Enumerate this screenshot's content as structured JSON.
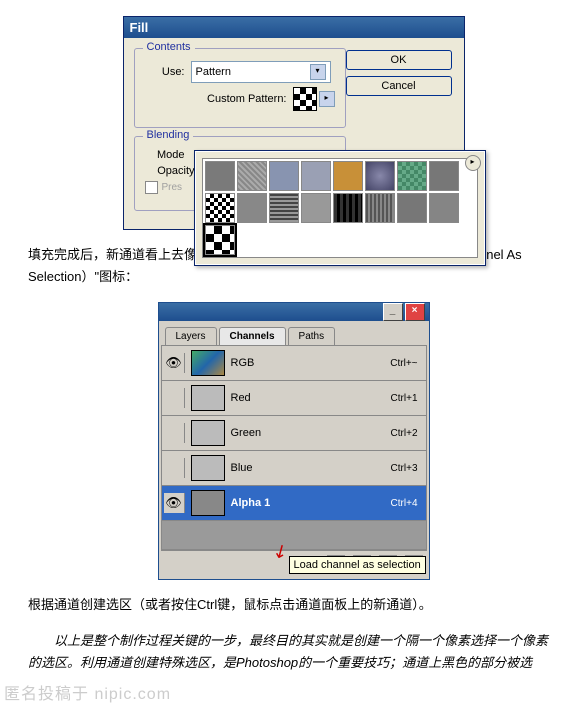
{
  "fill_dialog": {
    "title": "Fill",
    "contents_legend": "Contents",
    "use_label": "Use:",
    "use_value": "Pattern",
    "custom_pattern_label": "Custom Pattern:",
    "blending_legend": "Blending",
    "mode_label": "Mode",
    "opacity_label": "Opacity",
    "preserve_label": "Preserve Transparency",
    "ok": "OK",
    "cancel": "Cancel"
  },
  "para1": "填充完成后，新通道看上去像是灰色的。点击通道面板的\"创建选区（Load Channel As Selection）\"图标：",
  "channels_panel": {
    "tabs": [
      "Layers",
      "Channels",
      "Paths"
    ],
    "active_tab": 1,
    "rows": [
      {
        "name": "RGB",
        "shortcut": "Ctrl+~",
        "eye": true
      },
      {
        "name": "Red",
        "shortcut": "Ctrl+1",
        "eye": false
      },
      {
        "name": "Green",
        "shortcut": "Ctrl+2",
        "eye": false
      },
      {
        "name": "Blue",
        "shortcut": "Ctrl+3",
        "eye": false
      },
      {
        "name": "Alpha 1",
        "shortcut": "Ctrl+4",
        "eye": true,
        "selected": true
      }
    ],
    "tooltip": "Load channel as selection"
  },
  "para2": "根据通道创建选区（或者按住Ctrl键，鼠标点击通道面板上的新通道）。",
  "para3": "以上是整个制作过程关键的一步，最终目的其实就是创建一个隔一个像素选择一个像素的选区。利用通道创建特殊选区，是Photoshop的一个重要技巧；通道上黑色的部分被选",
  "watermark": "匿名投稿于 nipic.com"
}
